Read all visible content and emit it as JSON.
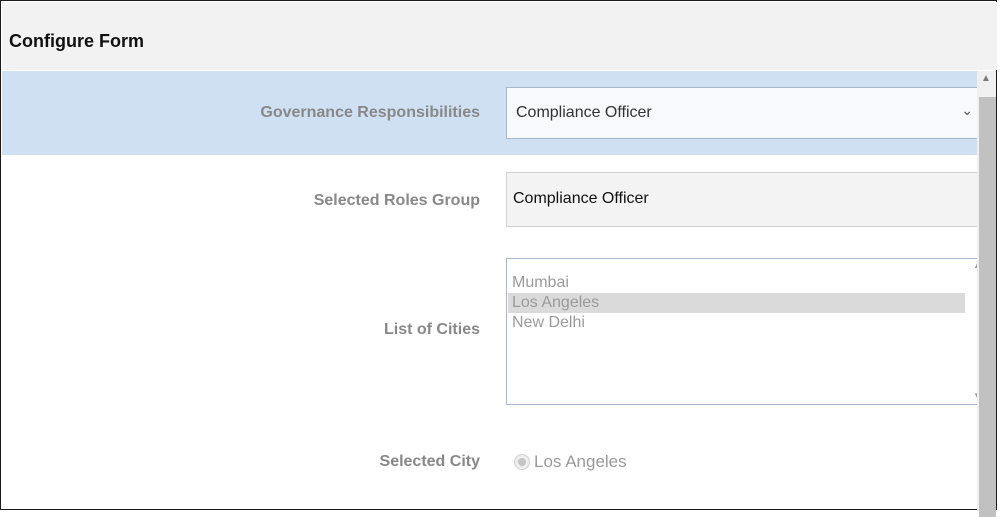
{
  "form": {
    "title": "Configure Form"
  },
  "fields": {
    "governance": {
      "label": "Governance Responsibilities",
      "value": "Compliance Officer",
      "chevron": "⌄"
    },
    "roles_group": {
      "label": "Selected Roles Group",
      "value": "Compliance Officer"
    },
    "cities": {
      "label": "List of Cities",
      "items": [
        "Mumbai",
        "Los Angeles",
        "New Delhi"
      ],
      "selected": "Los Angeles"
    },
    "selected_city": {
      "label": "Selected City",
      "value": "Los Angeles"
    }
  },
  "icons": {
    "scroll_up": "▲",
    "list_up": "▲",
    "list_down": "▼"
  },
  "colors": {
    "highlight_row": "#cfe0f3",
    "label_text": "#888888",
    "select_border": "#a7b8cc",
    "list_selected": "#dadada"
  }
}
